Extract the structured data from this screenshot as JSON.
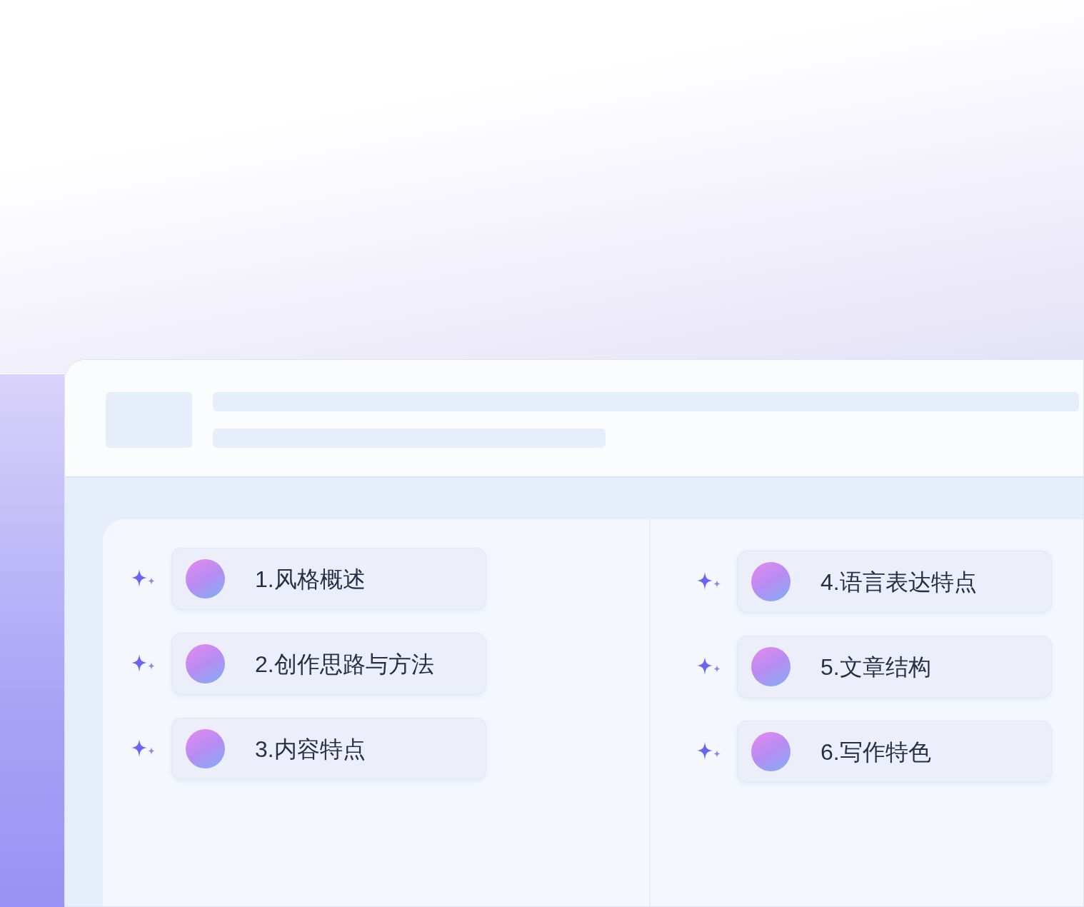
{
  "columns": [
    {
      "items": [
        {
          "label": "1.风格概述"
        },
        {
          "label": "2.创作思路与方法"
        },
        {
          "label": "3.内容特点"
        }
      ]
    },
    {
      "items": [
        {
          "label": "4.语言表达特点"
        },
        {
          "label": "5.文章结构"
        },
        {
          "label": "6.写作特色"
        }
      ]
    }
  ]
}
